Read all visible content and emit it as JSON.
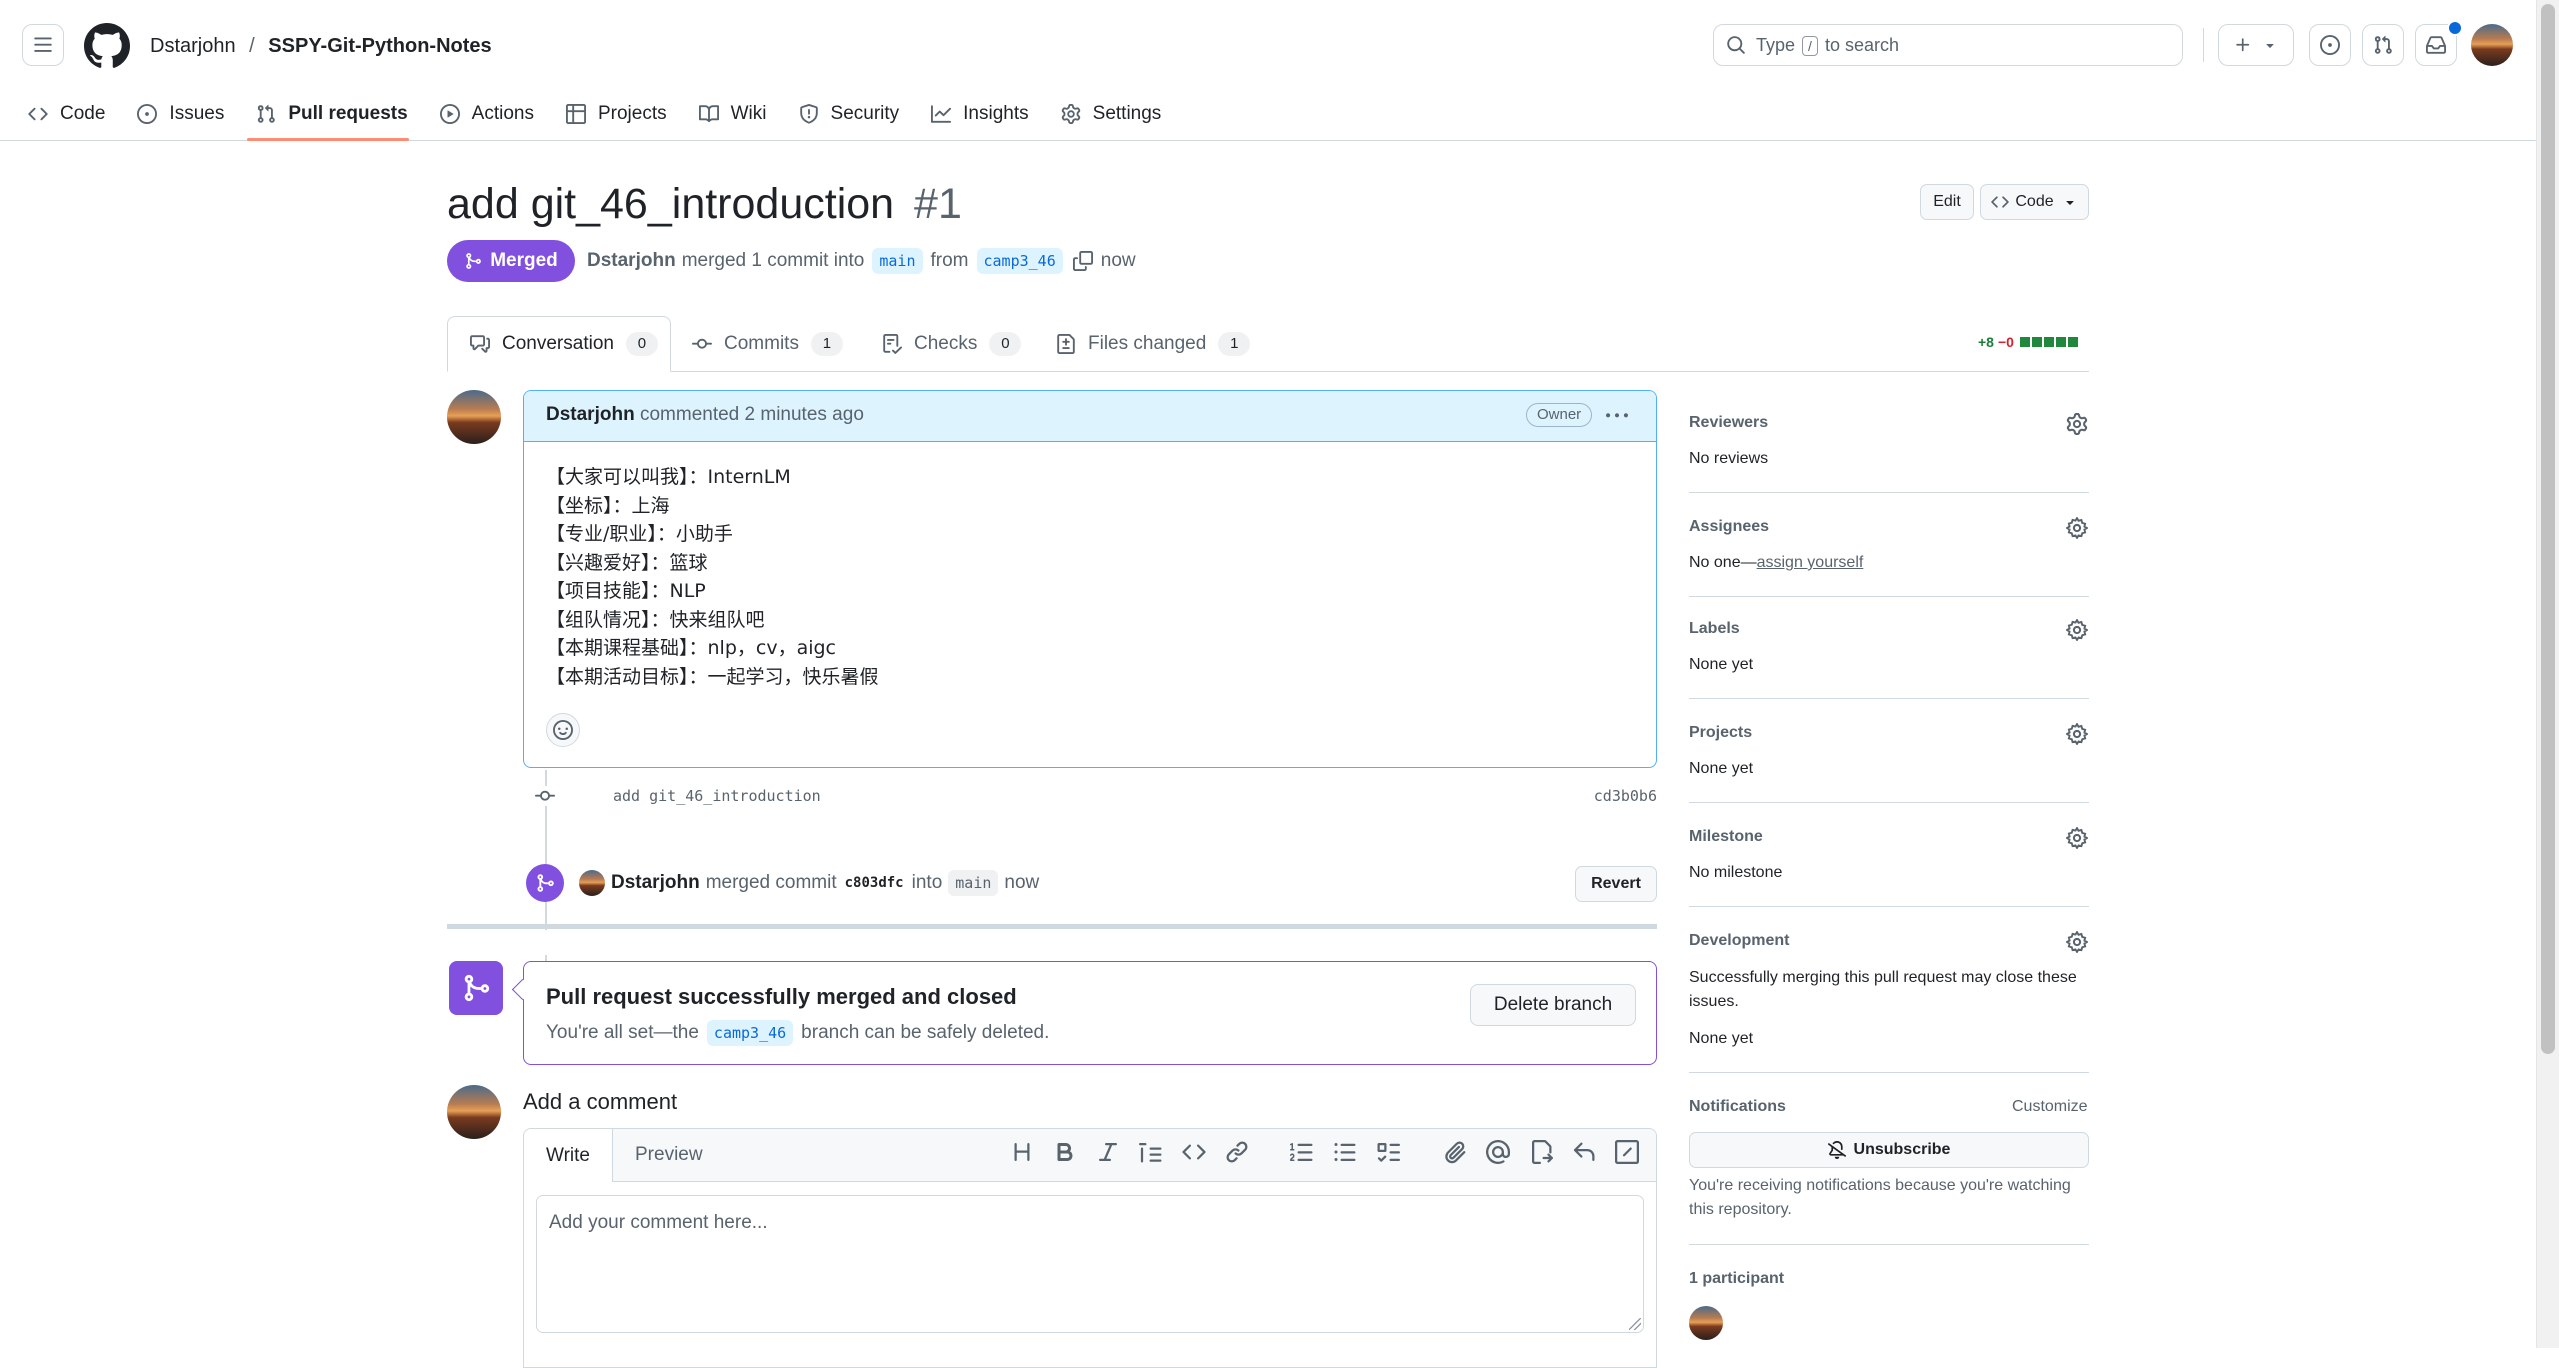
{
  "header": {
    "owner": "Dstarjohn",
    "separator": "/",
    "repo": "SSPY-Git-Python-Notes",
    "search_prefix": "Type",
    "search_key": "/",
    "search_suffix": "to search"
  },
  "repo_nav": [
    {
      "label": "Code",
      "icon": "code-icon"
    },
    {
      "label": "Issues",
      "icon": "issue-icon"
    },
    {
      "label": "Pull requests",
      "icon": "pull-request-icon",
      "selected": true
    },
    {
      "label": "Actions",
      "icon": "play-icon"
    },
    {
      "label": "Projects",
      "icon": "table-icon"
    },
    {
      "label": "Wiki",
      "icon": "book-icon"
    },
    {
      "label": "Security",
      "icon": "shield-icon"
    },
    {
      "label": "Insights",
      "icon": "graph-icon"
    },
    {
      "label": "Settings",
      "icon": "gear-icon"
    }
  ],
  "pr": {
    "title": "add git_46_introduction",
    "number": "#1",
    "state": "Merged",
    "author": "Dstarjohn",
    "summary": "merged 1 commit into",
    "base": "main",
    "from_word": "from",
    "head": "camp3_46",
    "time": "now",
    "edit_label": "Edit",
    "code_label": "Code"
  },
  "tabs": [
    {
      "label": "Conversation",
      "count": "0"
    },
    {
      "label": "Commits",
      "count": "1"
    },
    {
      "label": "Checks",
      "count": "0"
    },
    {
      "label": "Files changed",
      "count": "1"
    }
  ],
  "diffstat": {
    "added": "+8",
    "removed": "−0"
  },
  "comment": {
    "author": "Dstarjohn",
    "action": "commented",
    "time": "2 minutes ago",
    "badge": "Owner",
    "lines": [
      "【大家可以叫我】：InternLM",
      "【坐标】：上海",
      "【专业/职业】：小助手",
      "【兴趣爱好】：篮球",
      "【项目技能】：NLP",
      "【组队情况】：快来组队吧",
      "【本期课程基础】：nlp，cv，aigc",
      "【本期活动目标】：一起学习，快乐暑假"
    ]
  },
  "commit": {
    "message": "add git_46_introduction",
    "sha": "cd3b0b6"
  },
  "merge_event": {
    "author": "Dstarjohn",
    "text1": "merged commit",
    "sha": "c803dfc",
    "text2": "into",
    "branch": "main",
    "time": "now",
    "revert_label": "Revert"
  },
  "merged_box": {
    "title": "Pull request successfully merged and closed",
    "text_before": "You're all set—the",
    "branch": "camp3_46",
    "text_after": "branch can be safely deleted.",
    "delete_label": "Delete branch"
  },
  "add_comment": {
    "heading": "Add a comment",
    "write_tab": "Write",
    "preview_tab": "Preview",
    "placeholder": "Add your comment here..."
  },
  "sidebar": {
    "reviewers": {
      "title": "Reviewers",
      "value": "No reviews"
    },
    "assignees": {
      "title": "Assignees",
      "value_prefix": "No one—",
      "link": "assign yourself"
    },
    "labels": {
      "title": "Labels",
      "value": "None yet"
    },
    "projects": {
      "title": "Projects",
      "value": "None yet"
    },
    "milestone": {
      "title": "Milestone",
      "value": "No milestone"
    },
    "development": {
      "title": "Development",
      "text": "Successfully merging this pull request may close these issues.",
      "value": "None yet"
    },
    "notifications": {
      "title": "Notifications",
      "customize": "Customize",
      "unsubscribe": "Unsubscribe",
      "reason": "You're receiving notifications because you're watching this repository."
    },
    "participants": {
      "title": "1 participant"
    }
  },
  "colors": {
    "accent": "#8250df",
    "link": "#0969da",
    "added": "#1a7f37",
    "removed": "#d1242f"
  }
}
